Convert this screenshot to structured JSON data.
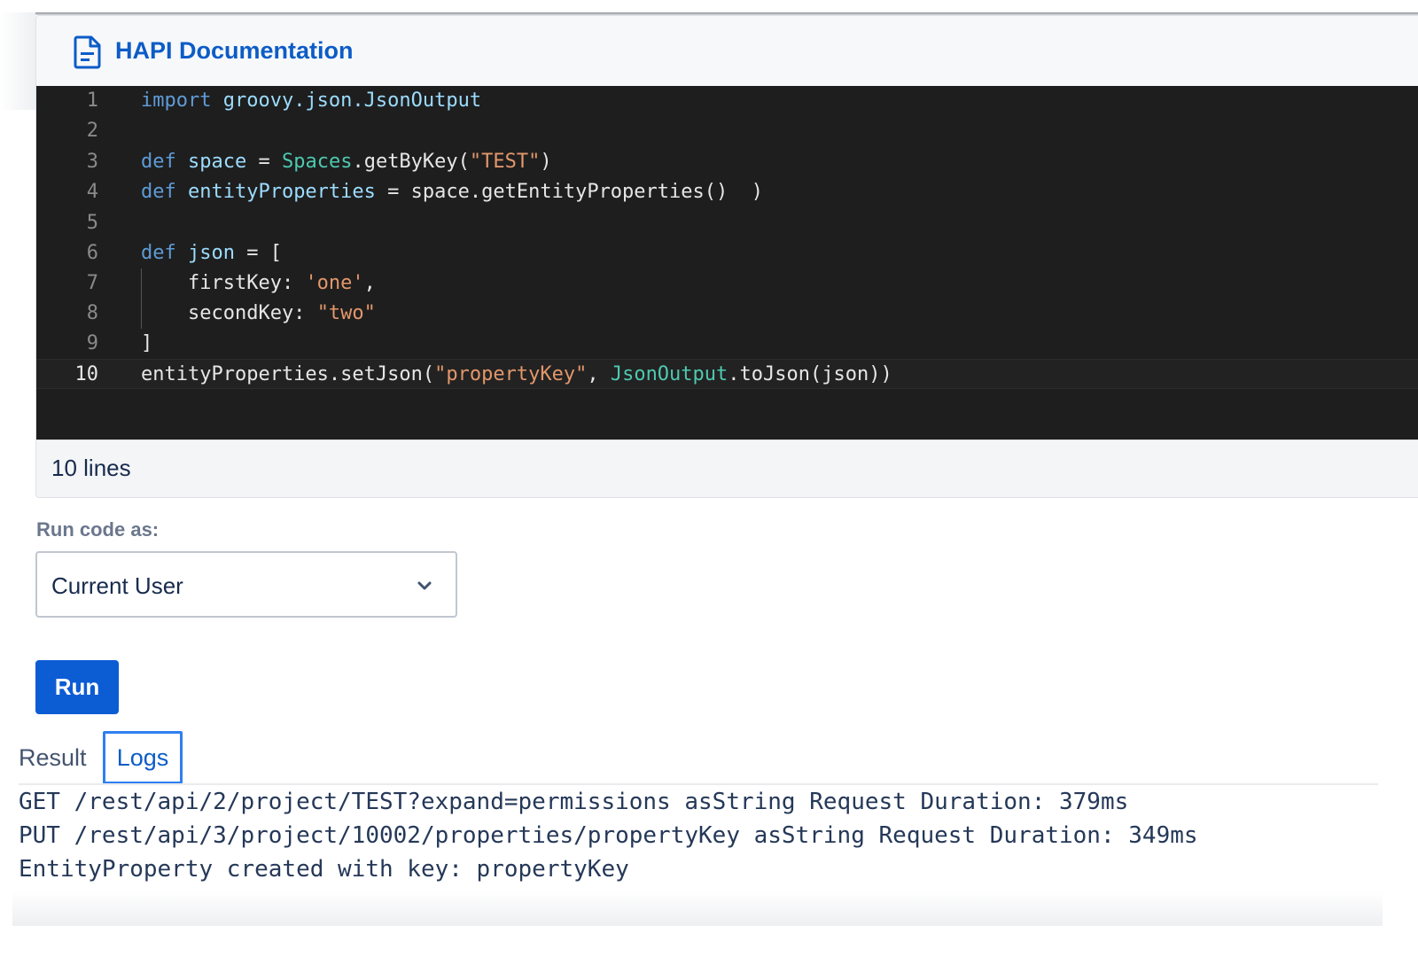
{
  "panel": {
    "title": "HAPI Documentation",
    "icon": "document-icon",
    "status": "10 lines"
  },
  "editor": {
    "lines": [
      {
        "num": "1",
        "tokens": [
          [
            "kw",
            "import "
          ],
          [
            "var",
            "groovy.json.JsonOutput"
          ]
        ]
      },
      {
        "num": "2",
        "tokens": []
      },
      {
        "num": "3",
        "tokens": [
          [
            "kw",
            "def "
          ],
          [
            "var",
            "space"
          ],
          [
            "plain",
            " = "
          ],
          [
            "cls",
            "Spaces"
          ],
          [
            "plain",
            ".getByKey("
          ],
          [
            "str",
            "\"TEST\""
          ],
          [
            "plain",
            ")"
          ]
        ]
      },
      {
        "num": "4",
        "tokens": [
          [
            "kw",
            "def "
          ],
          [
            "var",
            "entityProperties"
          ],
          [
            "plain",
            " = space.getEntityProperties()  )"
          ]
        ]
      },
      {
        "num": "5",
        "tokens": []
      },
      {
        "num": "6",
        "tokens": [
          [
            "kw",
            "def "
          ],
          [
            "var",
            "json"
          ],
          [
            "plain",
            " = ["
          ]
        ]
      },
      {
        "num": "7",
        "tokens": [
          [
            "plain",
            "    firstKey: "
          ],
          [
            "str",
            "'one'"
          ],
          [
            "plain",
            ","
          ]
        ]
      },
      {
        "num": "8",
        "tokens": [
          [
            "plain",
            "    secondKey: "
          ],
          [
            "str",
            "\"two\""
          ]
        ]
      },
      {
        "num": "9",
        "tokens": [
          [
            "plain",
            "]"
          ]
        ]
      },
      {
        "num": "10",
        "tokens": [
          [
            "plain",
            "entityProperties.setJson("
          ],
          [
            "str",
            "\"propertyKey\""
          ],
          [
            "plain",
            ", "
          ],
          [
            "cls",
            "JsonOutput"
          ],
          [
            "plain",
            ".toJson(json))"
          ]
        ]
      }
    ],
    "active_line": "10"
  },
  "run_as": {
    "label": "Run code as:",
    "selected": "Current User"
  },
  "run_button": {
    "label": "Run"
  },
  "tabs": {
    "result": "Result",
    "logs": "Logs",
    "active": "Logs"
  },
  "logs": [
    "GET /rest/api/2/project/TEST?expand=permissions asString Request Duration: 379ms",
    "PUT /rest/api/3/project/10002/properties/propertyKey asString Request Duration: 349ms",
    "EntityProperty created with key: propertyKey"
  ],
  "colors": {
    "accent": "#0c5cd4",
    "title": "#0c5cc7",
    "editor_bg": "#1e1e1e",
    "keyword": "#5e9bd6",
    "variable": "#9cdcfe",
    "class": "#4ec9b0",
    "string": "#e3976b"
  }
}
